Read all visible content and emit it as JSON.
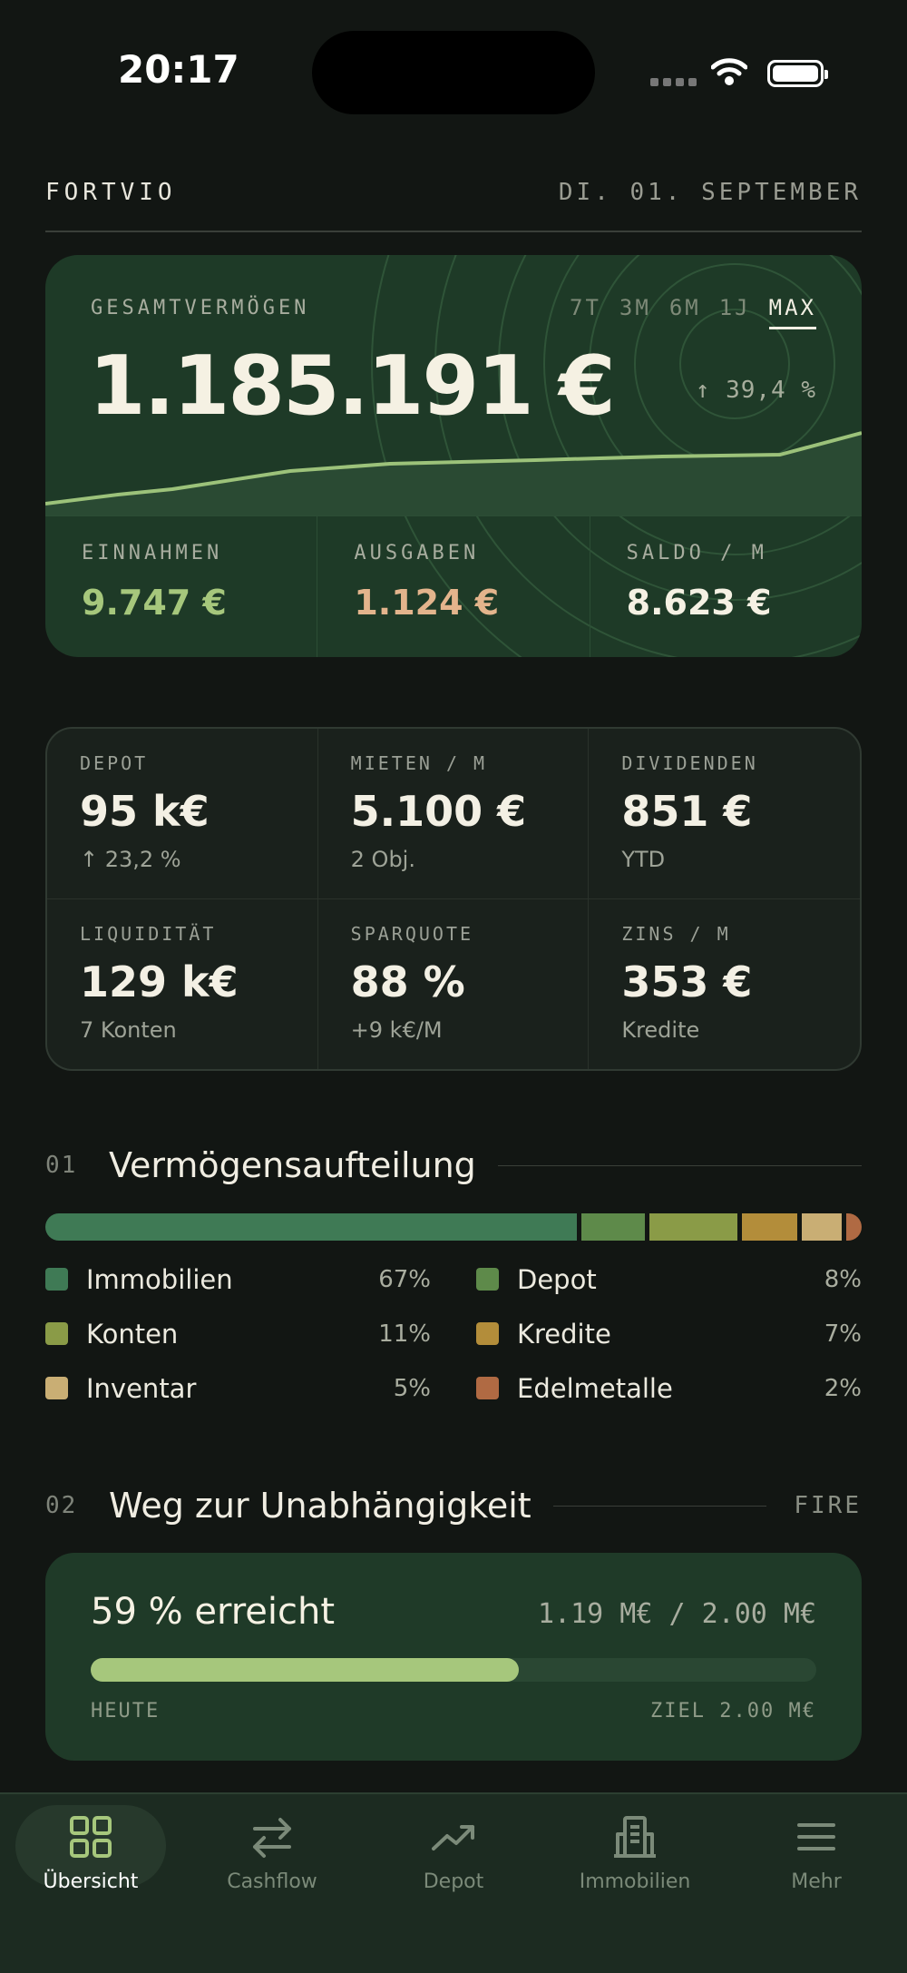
{
  "status": {
    "time": "20:17"
  },
  "header": {
    "brand": "FORTVIO",
    "date": "DI. 01. SEPTEMBER"
  },
  "overview": {
    "label": "GESAMTVERMÖGEN",
    "ranges": [
      "7T",
      "3M",
      "6M",
      "1J",
      "MAX"
    ],
    "active_range": "MAX",
    "total": "1.185.191 €",
    "change": "↑ 39,4 %",
    "income_label": "EINNAHMEN",
    "income_value": "9.747 €",
    "expense_label": "AUSGABEN",
    "expense_value": "1.124 €",
    "balance_label": "SALDO / M",
    "balance_value": "8.623 €"
  },
  "stats": [
    {
      "label": "DEPOT",
      "value": "95 k€",
      "sub": "↑ 23,2 %"
    },
    {
      "label": "MIETEN / M",
      "value": "5.100 €",
      "sub": "2 Obj."
    },
    {
      "label": "DIVIDENDEN",
      "value": "851 €",
      "sub": "YTD"
    },
    {
      "label": "LIQUIDITÄT",
      "value": "129 k€",
      "sub": "7 Konten"
    },
    {
      "label": "SPARQUOTE",
      "value": "88 %",
      "sub": "+9 k€/M"
    },
    {
      "label": "ZINS / M",
      "value": "353 €",
      "sub": "Kredite"
    }
  ],
  "allocation": {
    "number": "01",
    "title": "Vermögensaufteilung",
    "items": [
      {
        "name": "Immobilien",
        "pct": "67%",
        "share": 67,
        "color": "#3f7a55"
      },
      {
        "name": "Depot",
        "pct": "8%",
        "share": 8,
        "color": "#5e8a4a"
      },
      {
        "name": "Konten",
        "pct": "11%",
        "share": 11,
        "color": "#8a9b47"
      },
      {
        "name": "Kredite",
        "pct": "7%",
        "share": 7,
        "color": "#b38d3a"
      },
      {
        "name": "Inventar",
        "pct": "5%",
        "share": 5,
        "color": "#c9ae74"
      },
      {
        "name": "Edelmetalle",
        "pct": "2%",
        "share": 2,
        "color": "#b06a43"
      }
    ]
  },
  "fire": {
    "number": "02",
    "title": "Weg zur Unabhängigkeit",
    "tag": "FIRE",
    "reached": "59 % erreicht",
    "progress_text": "1.19 M€ / 2.00 M€",
    "progress": 0.59,
    "left_label": "HEUTE",
    "right_label": "ZIEL 2.00 M€"
  },
  "tabbar": {
    "tabs": [
      {
        "label": "Übersicht",
        "icon": "grid-icon",
        "active": true
      },
      {
        "label": "Cashflow",
        "icon": "arrows-icon"
      },
      {
        "label": "Depot",
        "icon": "trend-icon"
      },
      {
        "label": "Immobilien",
        "icon": "building-icon"
      },
      {
        "label": "Mehr",
        "icon": "menu-icon"
      }
    ]
  }
}
